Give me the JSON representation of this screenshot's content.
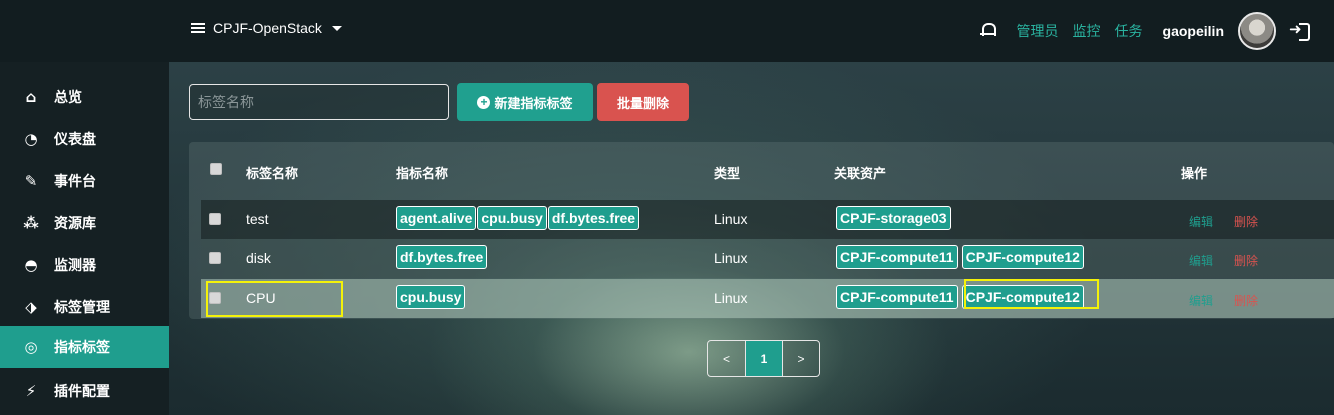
{
  "topbar": {
    "project": "CPJF-OpenStack",
    "links": [
      "管理员",
      "监控",
      "任务"
    ],
    "username": "gaopeilin"
  },
  "sidebar": {
    "items": [
      {
        "label": "总览",
        "icon": "home-icon"
      },
      {
        "label": "仪表盘",
        "icon": "pie-chart-icon"
      },
      {
        "label": "事件台",
        "icon": "edit-icon"
      },
      {
        "label": "资源库",
        "icon": "cubes-icon"
      },
      {
        "label": "监测器",
        "icon": "dashboard-icon"
      },
      {
        "label": "标签管理",
        "icon": "tags-icon"
      },
      {
        "label": "指标标签",
        "icon": "bullseye-icon",
        "active": true
      },
      {
        "label": "插件配置",
        "icon": "plug-icon"
      }
    ]
  },
  "toolbar": {
    "search_placeholder": "标签名称",
    "new_label": "新建指标标签",
    "batch_delete_label": "批量删除"
  },
  "table": {
    "headers": [
      "标签名称",
      "指标名称",
      "类型",
      "关联资产",
      "操作"
    ],
    "rows": [
      {
        "name": "test",
        "metrics": [
          "agent.alive",
          "cpu.busy",
          "df.bytes.free"
        ],
        "type": "Linux",
        "assets": [
          "CPJF-storage03"
        ],
        "edit": "编辑",
        "delete": "删除"
      },
      {
        "name": "disk",
        "metrics": [
          "df.bytes.free"
        ],
        "type": "Linux",
        "assets": [
          "CPJF-compute11",
          "CPJF-compute12"
        ],
        "edit": "编辑",
        "delete": "删除"
      },
      {
        "name": "CPU",
        "metrics": [
          "cpu.busy"
        ],
        "type": "Linux",
        "assets": [
          "CPJF-compute11",
          "CPJF-compute12"
        ],
        "edit": "编辑",
        "delete": "删除"
      }
    ]
  },
  "pagination": {
    "prev": "<",
    "current": "1",
    "next": ">"
  },
  "colors": {
    "accent": "#1f9e8e",
    "danger": "#d9534f",
    "highlight": "#f4f20a"
  }
}
